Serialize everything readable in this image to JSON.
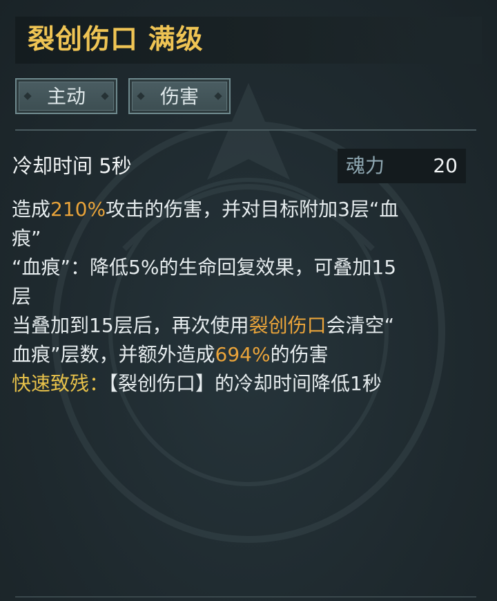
{
  "skill": {
    "title": "裂创伤口 满级",
    "tags": [
      "主动",
      "伤害"
    ],
    "cooldown": "冷却时间 5秒",
    "cost": {
      "label": "魂力",
      "value": "20"
    }
  },
  "description": {
    "line1_a": "造成",
    "line1_hl": "210%",
    "line1_b": "攻击的伤害，并对目标附加3层“血",
    "line2": "痕”",
    "line3": "“血痕”：降低5%的生命回复效果，可叠加15",
    "line4": "层",
    "line5_a": "当叠加到15层后，再次使用",
    "line5_hl": "裂创伤口",
    "line5_b": "会清空“",
    "line6_a": "血痕”层数，并额外造成",
    "line6_hl": "694%",
    "line6_b": "的伤害",
    "perk_name": "快速致残：",
    "perk_text": "【裂创伤口】的冷却时间降低1秒"
  },
  "colors": {
    "title": "#efc454",
    "highlight": "#eaa43a",
    "perk": "#e8c24a",
    "background": "#1e282c"
  }
}
